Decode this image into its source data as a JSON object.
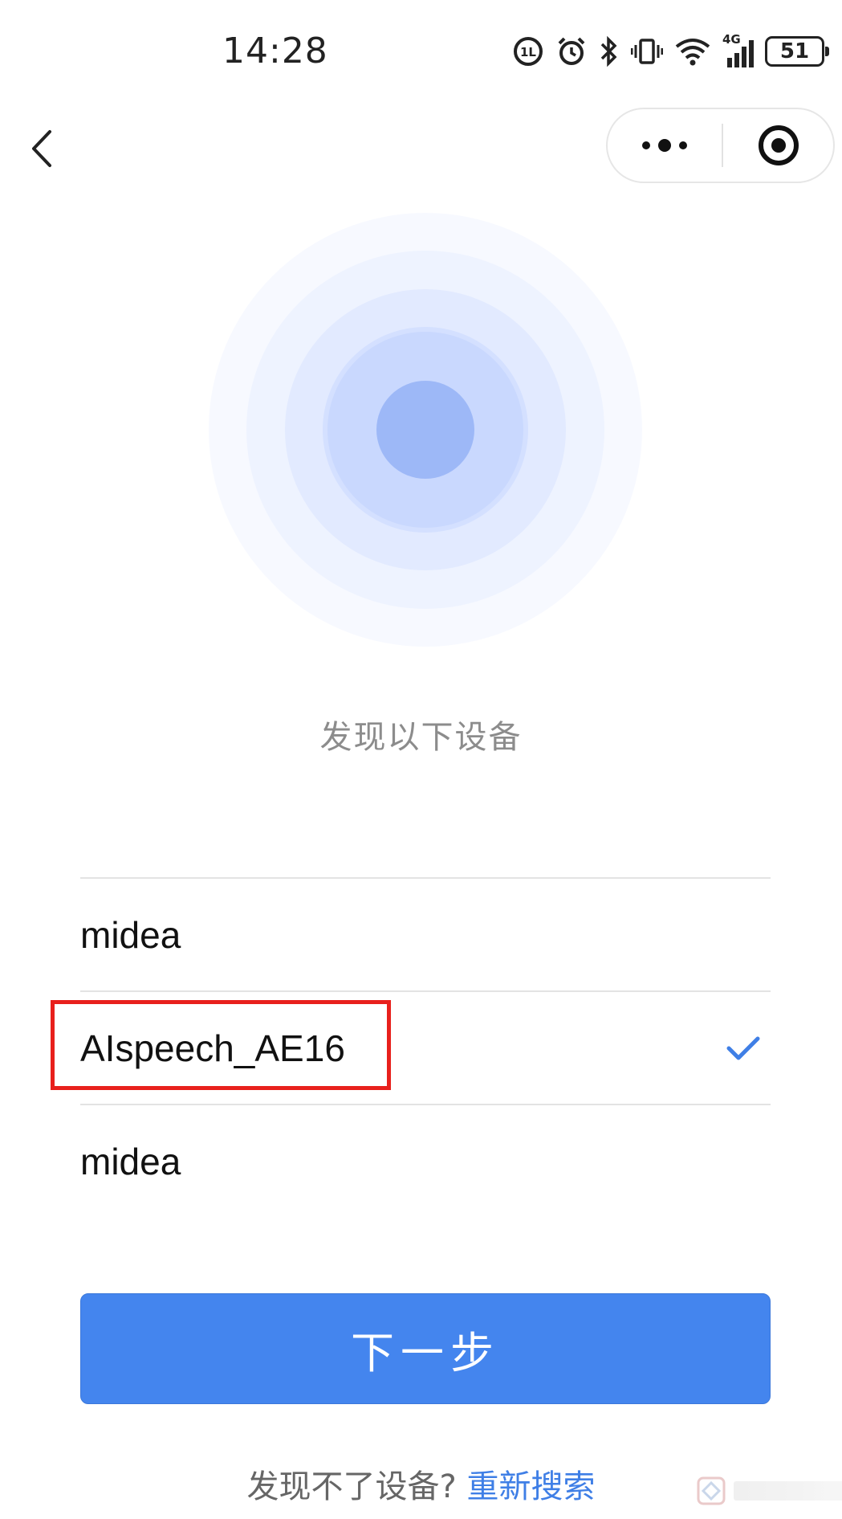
{
  "status_bar": {
    "time": "14:28",
    "network": "4G",
    "battery": "51"
  },
  "nav": {
    "back_icon": "chevron-left-icon",
    "more_icon": "more-dots-icon",
    "close_icon": "target-circle-icon"
  },
  "radar": {
    "colors": [
      "#f7f9ff",
      "#eef3ff",
      "#e2eaff",
      "#d4e0ff",
      "#c5d5fd",
      "#9db8f7"
    ]
  },
  "scan": {
    "title": "发现以下设备"
  },
  "devices": [
    {
      "name": "midea",
      "selected": false
    },
    {
      "name": "AIspeech_AE16",
      "selected": true
    },
    {
      "name": "midea",
      "selected": false
    }
  ],
  "actions": {
    "next_label": "下一步"
  },
  "footer": {
    "question": "发现不了设备?",
    "research_link": "重新搜索"
  },
  "colors": {
    "primary": "#4485ee",
    "highlight": "#e8201c",
    "link": "#3f7fe6"
  }
}
